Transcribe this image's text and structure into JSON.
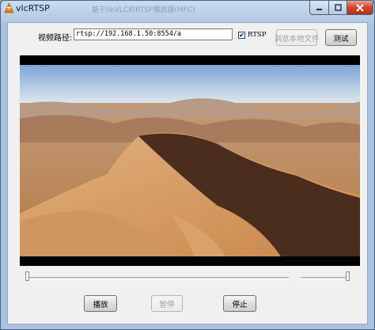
{
  "window": {
    "title": "vlcRTSP",
    "background_title": "基于libVLC的RTSP播放器(MFC)"
  },
  "form": {
    "path_label": "视频路径:",
    "path_value": "rtsp://192.168.1.50:8554/a",
    "rtsp_label": "RTSP",
    "rtsp_checked": true,
    "browse_label": "浏览本地文件",
    "browse_enabled": false,
    "test_label": "测试"
  },
  "controls": {
    "play_label": "播放",
    "pause_label": "暂停",
    "pause_enabled": false,
    "stop_label": "停止"
  },
  "progress": {
    "position": 0
  },
  "volume": {
    "level": 1
  },
  "video": {
    "scene": "aerial desert dunes",
    "accent_sky": "#a9c4e6",
    "sand": "#c98d54"
  },
  "colors": {
    "frame": "#b4cbe4",
    "close": "#c9452a"
  }
}
